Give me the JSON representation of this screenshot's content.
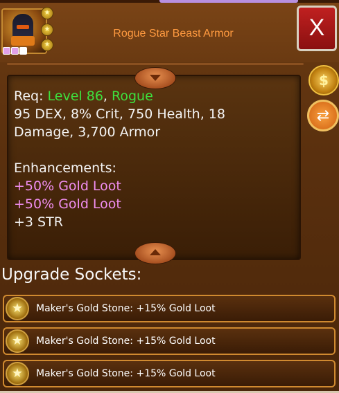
{
  "item": {
    "title": "Rogue Star Beast Armor",
    "requirement_prefix": "Req: ",
    "requirement_level": "Level 86",
    "requirement_sep": ", ",
    "requirement_class": "Rogue",
    "stats_line_1": "95 DEX, 8% Crit, 750 Health, 18",
    "stats_line_2": "Damage, 3,700 Armor",
    "enhancements_label": "Enhancements:",
    "enhancements": [
      "+50% Gold Loot",
      "+50% Gold Loot",
      "+3 STR"
    ]
  },
  "header": {
    "close_label": "X"
  },
  "icons": {
    "portrait": "armor-portrait-icon",
    "star_badge": "star-badge-icon",
    "gold_bag": "gold-bag-icon",
    "swap": "swap-arrows-icon",
    "scroll_up": "scroll-up-icon",
    "scroll_down": "scroll-down-icon",
    "socket_gem": "gold-star-gem-icon"
  },
  "sockets": {
    "title": "Upgrade Sockets:",
    "items": [
      {
        "label": "Maker's Gold Stone: +15% Gold Loot"
      },
      {
        "label": "Maker's Gold Stone: +15% Gold Loot"
      },
      {
        "label": "Maker's Gold Stone: +15% Gold Loot"
      }
    ]
  },
  "colors": {
    "title": "#ff9a40",
    "requirement": "#3ee03e",
    "enhancement": "#f08ef0",
    "close_button": "#c02020"
  }
}
